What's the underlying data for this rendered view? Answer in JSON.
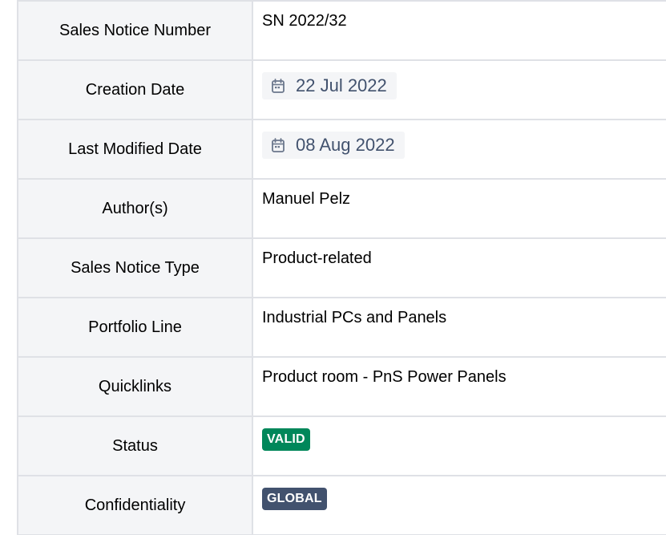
{
  "properties": {
    "sales_notice_number": {
      "label": "Sales Notice Number",
      "value": "SN 2022/32"
    },
    "creation_date": {
      "label": "Creation Date",
      "value": "22 Jul 2022",
      "icon": "calendar-icon"
    },
    "last_modified_date": {
      "label": "Last Modified Date",
      "value": "08 Aug 2022",
      "icon": "calendar-icon"
    },
    "authors": {
      "label": "Author(s)",
      "value": "Manuel Pelz"
    },
    "sales_notice_type": {
      "label": "Sales Notice Type",
      "value": "Product-related"
    },
    "portfolio_line": {
      "label": "Portfolio Line",
      "value": "Industrial PCs and Panels"
    },
    "quicklinks": {
      "label": "Quicklinks",
      "value": "Product room - PnS Power Panels"
    },
    "status": {
      "label": "Status",
      "value": "VALID",
      "color": "#00875a"
    },
    "confidentiality": {
      "label": "Confidentiality",
      "value": "GLOBAL",
      "color": "#42526e"
    }
  },
  "colors": {
    "header_bg": "#f4f5f7",
    "border": "#dfe1e6",
    "chip_text": "#42526e"
  }
}
